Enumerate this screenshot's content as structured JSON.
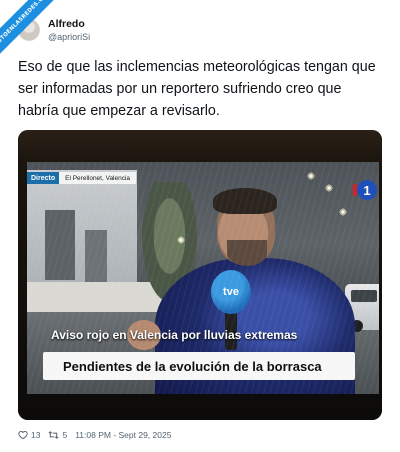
{
  "badge": {
    "text": "VISTOENLASREDES.COM"
  },
  "tweet": {
    "display_name": "Alfredo",
    "handle": "@aprioriSi",
    "text": "Eso de que las inclemencias meteorológicas tengan que ser informadas por un reportero sufriendo creo que habría que empezar a revisarlo.",
    "likes": "13",
    "retweets": "5",
    "timestamp": "11:08 PM - Sept 29, 2025"
  },
  "broadcast": {
    "live_label": "Directo",
    "location": "El Perellonet, Valencia",
    "channel": "1",
    "mic_logo": "tve",
    "headline": "Aviso rojo en Valencia por lluvias extremas",
    "subheadline": "Pendientes de la evolución de la borrasca"
  },
  "colors": {
    "accent": "#1d8fe0",
    "live_tag": "#1c6ea8",
    "channel_blue": "#1f4fb8",
    "channel_red": "#d2232a"
  },
  "icons": {
    "like": "heart-icon",
    "retweet": "retweet-icon"
  }
}
